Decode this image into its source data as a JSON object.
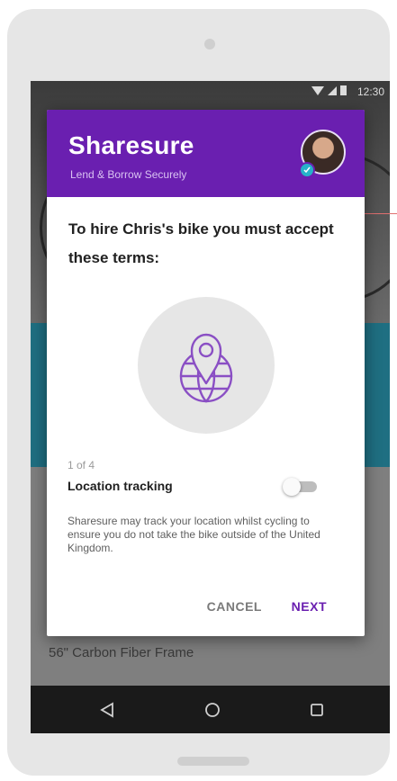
{
  "status_bar": {
    "time": "12:30"
  },
  "dialog": {
    "app_title": "Sharesure",
    "app_subtitle": "Lend & Borrow Securely",
    "prompt": "To hire Chris's bike you must accept these terms:",
    "icon": "location-globe-icon",
    "step": "1 of 4",
    "term_title": "Location tracking",
    "toggle_on": false,
    "term_description": "Sharesure may track your location whilst cycling to ensure you do not take the bike outside of the United Kingdom.",
    "cancel_label": "CANCEL",
    "next_label": "NEXT"
  },
  "background": {
    "spec_text": "56\" Carbon Fiber Frame"
  },
  "navbar": {
    "icons": [
      "back-icon",
      "home-icon",
      "recents-icon"
    ]
  },
  "colors": {
    "brand_purple": "#6a1fb0",
    "teal_band": "#1f6f82",
    "verified_badge": "#27b1c9"
  }
}
